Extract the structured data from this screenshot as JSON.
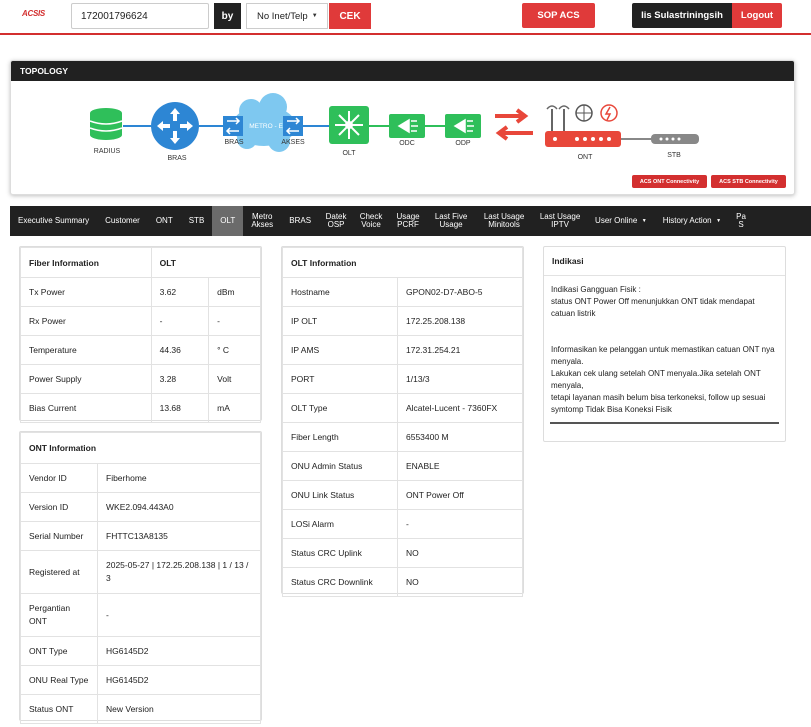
{
  "header": {
    "logo": "ACSIS",
    "search_value": "172001796624",
    "by_label": "by",
    "select_value": "No Inet/Telp",
    "cek_label": "CEK",
    "sop_label": "SOP ACS",
    "user_name": "Iis Sulastriningsih",
    "logout_label": "Logout"
  },
  "topology": {
    "title": "TOPOLOGY",
    "nodes": {
      "radius": "RADIUS",
      "bras": "BRAS",
      "bras2": "BRAS",
      "metro": "METRO - E",
      "akses": "AKSES",
      "olt": "OLT",
      "odc": "ODC",
      "odp": "ODP",
      "ont": "ONT",
      "stb": "STB"
    },
    "acs_ont_label": "ACS ONT Connectivity",
    "acs_stb_label": "ACS STB Connectivity"
  },
  "tabs": [
    "Executive Summary",
    "Customer",
    "ONT",
    "STB",
    "OLT",
    "Metro Akses",
    "BRAS",
    "Datek OSP",
    "Check Voice",
    "Usage PCRF",
    "Last Five Usage",
    "Last Usage Minitools",
    "Last Usage IPTV",
    "User Online",
    "History Action",
    "Pa S"
  ],
  "fiber": {
    "h1": "Fiber Information",
    "h2": "OLT",
    "rows": [
      [
        "Tx Power",
        "3.62",
        "dBm"
      ],
      [
        "Rx Power",
        "-",
        "-"
      ],
      [
        "Temperature",
        "44.36",
        "° C"
      ],
      [
        "Power Supply",
        "3.28",
        "Volt"
      ],
      [
        "Bias Current",
        "13.68",
        "mA"
      ]
    ]
  },
  "ont": {
    "title": "ONT Information",
    "rows": [
      [
        "Vendor ID",
        "Fiberhome"
      ],
      [
        "Version ID",
        "WKE2.094.443A0"
      ],
      [
        "Serial Number",
        "FHTTC13A8135"
      ],
      [
        "Registered at",
        "2025-05-27 | 172.25.208.138 | 1 / 13 / 3"
      ],
      [
        "Pergantian ONT",
        "-"
      ],
      [
        "ONT Type",
        "HG6145D2"
      ],
      [
        "ONU Real Type",
        "HG6145D2"
      ],
      [
        "Status ONT",
        "New Version"
      ]
    ]
  },
  "olt": {
    "title": "OLT Information",
    "rows": [
      [
        "Hostname",
        "GPON02-D7-ABO-5"
      ],
      [
        "IP OLT",
        "172.25.208.138"
      ],
      [
        "IP AMS",
        "172.31.254.21"
      ],
      [
        "PORT",
        "1/13/3"
      ],
      [
        "OLT Type",
        "Alcatel-Lucent - 7360FX"
      ],
      [
        "Fiber Length",
        "6553400 M"
      ],
      [
        "ONU Admin Status",
        "ENABLE"
      ],
      [
        "ONU Link Status",
        "ONT Power Off"
      ],
      [
        "LOSi Alarm",
        "-"
      ],
      [
        "Status CRC Uplink",
        "NO"
      ],
      [
        "Status CRC Downlink",
        "NO"
      ]
    ]
  },
  "indikasi": {
    "title": "Indikasi",
    "p1": "Indikasi Gangguan Fisik :",
    "p2": "status ONT Power Off menunjukkan ONT tidak mendapat catuan listrik",
    "p3": "Informasikan ke pelanggan untuk memastikan catuan ONT nya menyala.",
    "p4": "Lakukan cek ulang setelah ONT menyala.Jika setelah ONT menyala,",
    "p5": "tetapi layanan masih belum bisa terkoneksi, follow up sesuai symtomp Tidak Bisa Koneksi Fisik"
  },
  "colors": {
    "accent": "#e03a3a",
    "dark": "#212121",
    "green": "#2fbf5a",
    "blue": "#2d86d4"
  }
}
